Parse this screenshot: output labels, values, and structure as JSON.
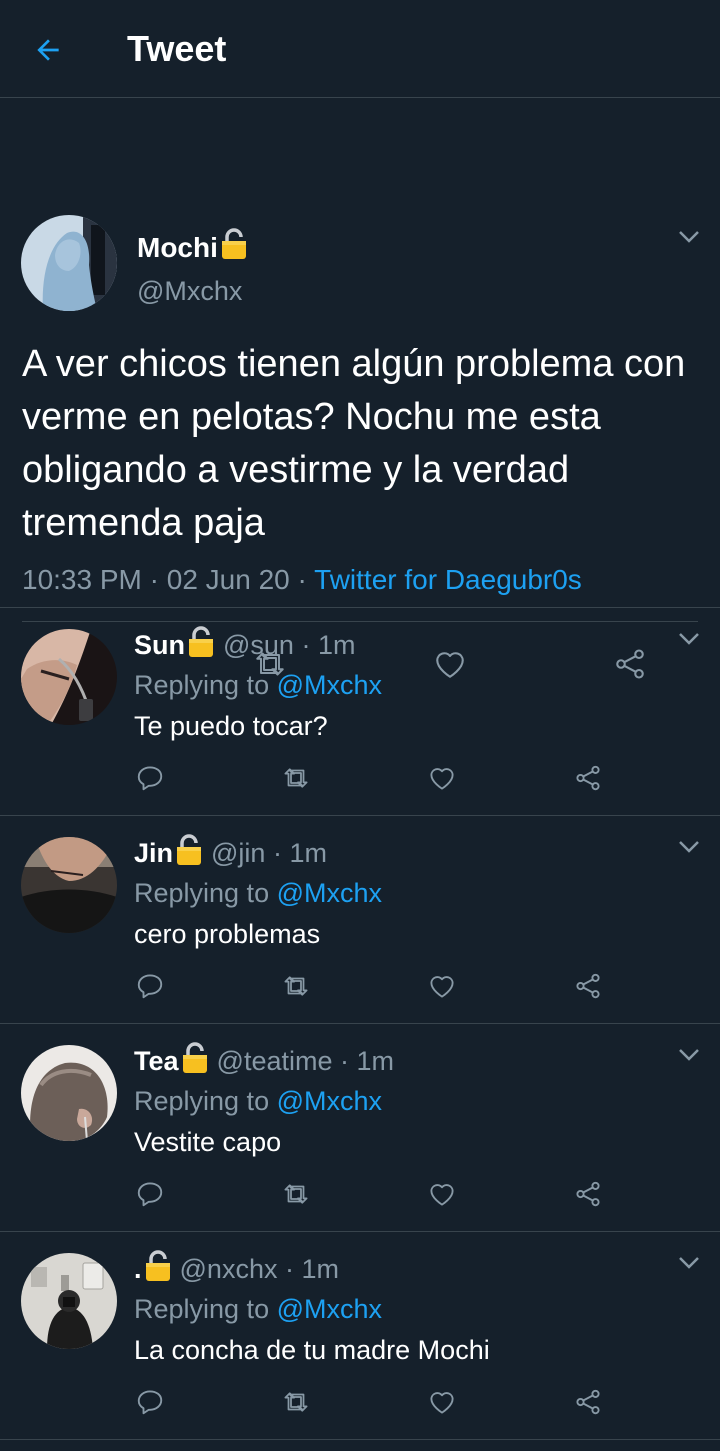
{
  "header": {
    "title": "Tweet"
  },
  "colors": {
    "background": "#15202b",
    "divider": "#38444d",
    "accent": "#1da1f2",
    "muted": "#8899a6",
    "text": "#ffffff"
  },
  "main_tweet": {
    "name": "Mochi",
    "handle": "@Mxchx",
    "text": "A ver chicos tienen algún problema con verme en pelotas? Nochu me esta obligando a vestirme y la verdad tremenda paja",
    "time": "10:33 PM",
    "date": "02 Jun 20",
    "source": "Twitter for Daegubr0s"
  },
  "replies": [
    {
      "name": "Sun",
      "handle": "@sun",
      "time": "1m",
      "replying_prefix": "Replying to",
      "mention": "@Mxchx",
      "text": "Te puedo tocar?"
    },
    {
      "name": "Jin",
      "handle": "@jin",
      "time": "1m",
      "replying_prefix": "Replying to",
      "mention": "@Mxchx",
      "text": "cero problemas"
    },
    {
      "name": "Tea",
      "handle": "@teatime",
      "time": "1m",
      "replying_prefix": "Replying to",
      "mention": "@Mxchx",
      "text": "Vestite capo"
    },
    {
      "name": ".",
      "handle": "@nxchx",
      "time": "1m",
      "replying_prefix": "Replying to",
      "mention": "@Mxchx",
      "text": "La concha de tu madre Mochi"
    }
  ],
  "icons": [
    "back-arrow-icon",
    "lock-icon",
    "chevron-down-icon",
    "reply-icon",
    "retweet-icon",
    "like-icon",
    "share-icon"
  ]
}
